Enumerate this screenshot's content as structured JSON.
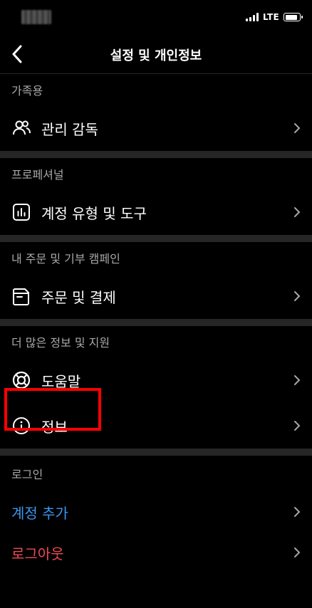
{
  "status_bar": {
    "network": "LTE",
    "battery_level": 0.85
  },
  "nav": {
    "title": "설정 및 개인정보",
    "back_icon": "chevron-left-icon"
  },
  "sections": [
    {
      "header": "가족용",
      "items": [
        {
          "label": "관리 감독",
          "icon": "supervision-users-icon"
        }
      ]
    },
    {
      "header": "프로페셔널",
      "items": [
        {
          "label": "계정 유형 및 도구",
          "icon": "bar-chart-icon"
        }
      ]
    },
    {
      "header": "내 주문 및 기부 캠페인",
      "items": [
        {
          "label": "주문 및 결제",
          "icon": "orders-icon"
        }
      ]
    },
    {
      "header": "더 많은 정보 및 지원",
      "items": [
        {
          "label": "도움말",
          "icon": "lifebuoy-icon"
        },
        {
          "label": "정보",
          "icon": "info-icon"
        }
      ]
    },
    {
      "header": "로그인",
      "items": [
        {
          "label": "계정 추가",
          "color": "#3897f0"
        },
        {
          "label": "로그아웃",
          "color": "#ed4956"
        }
      ]
    }
  ],
  "colors": {
    "background": "#000000",
    "divider": "#262626",
    "add_account": "#3897f0",
    "logout": "#ed4956",
    "highlight": "#ff0000"
  }
}
